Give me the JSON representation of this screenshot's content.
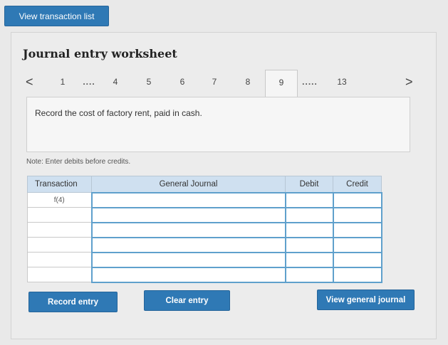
{
  "top": {
    "view_transaction_list": "View transaction list"
  },
  "worksheet": {
    "title": "Journal entry worksheet",
    "pager": {
      "prev": "<",
      "next": ">",
      "items": [
        "1",
        "....",
        "4",
        "5",
        "6",
        "7",
        "8",
        "9",
        ".....",
        "13"
      ],
      "active": "9"
    },
    "description": "Record the cost of factory rent, paid in cash.",
    "note": "Note: Enter debits before credits."
  },
  "table": {
    "headers": [
      "Transaction",
      "General Journal",
      "Debit",
      "Credit"
    ],
    "rows": [
      {
        "transaction": "f(4)"
      },
      {
        "transaction": ""
      },
      {
        "transaction": ""
      },
      {
        "transaction": ""
      },
      {
        "transaction": ""
      },
      {
        "transaction": ""
      }
    ]
  },
  "actions": {
    "record_entry": "Record entry",
    "clear_entry": "Clear entry",
    "view_general_journal": "View general journal"
  }
}
